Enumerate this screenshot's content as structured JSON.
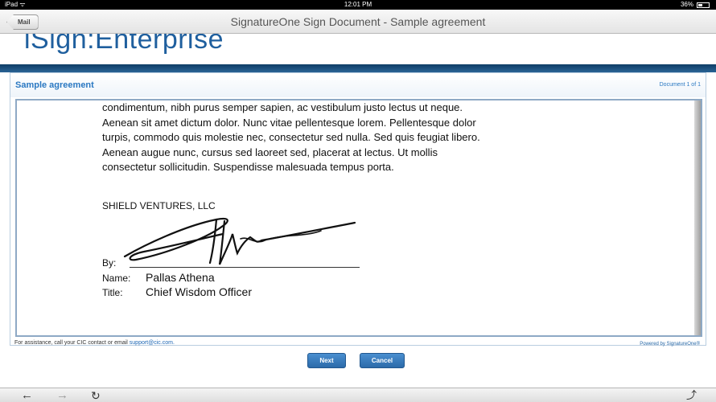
{
  "status_bar": {
    "carrier": "iPad ᯤ",
    "time": "12:01 PM",
    "battery": "36%"
  },
  "nav": {
    "back_label": "Mail",
    "title": "SignatureOne Sign Document - Sample agreement"
  },
  "brand": {
    "logo_text": "iSign:Enterprise"
  },
  "document": {
    "title": "Sample agreement",
    "counter": "Document 1 of 1",
    "body_lines": [
      "condimentum, nibh purus semper sapien, ac vestibulum justo lectus ut neque.",
      "Aenean sit amet dictum dolor. Nunc vitae pellentesque lorem. Pellentesque dolor",
      "turpis, commodo quis molestie nec, consectetur sed nulla. Sed quis feugiat libero.",
      "Aenean augue nunc, cursus sed laoreet sed, placerat at lectus. Ut mollis",
      "consectetur sollicitudin. Suspendisse malesuada tempus porta."
    ],
    "company": "SHIELD VENTURES, LLC",
    "by_label": "By:",
    "name_label": "Name:",
    "name_value": "Pallas Athena",
    "title_label": "Title:",
    "title_value": "Chief Wisdom Officer"
  },
  "footer": {
    "assist_text": "For assistance, call your CIC contact or email ",
    "assist_email": "support@cic.com.",
    "powered_by": "Powered by SignatureOne®",
    "next_label": "Next",
    "cancel_label": "Cancel"
  },
  "toolbar": {
    "back_icon": "back-arrow-icon",
    "forward_icon": "forward-arrow-icon",
    "reload_icon": "reload-icon",
    "share_icon": "share-icon"
  },
  "colors": {
    "accent": "#2a78c2",
    "brand": "#1f5f9e",
    "button": "#2b6aa9",
    "band": "#0f3d66"
  }
}
